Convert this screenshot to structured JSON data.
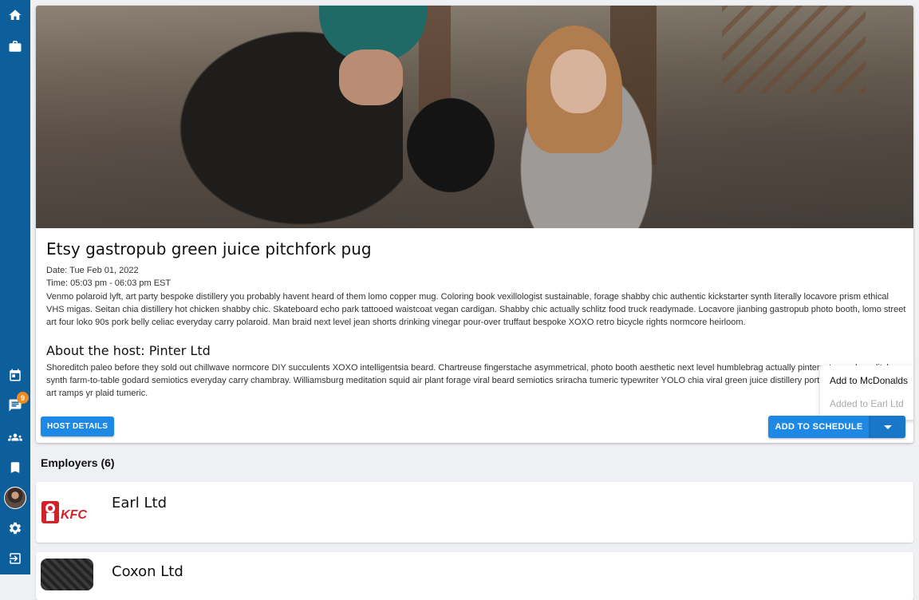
{
  "sidebar": {
    "badge_count": "9"
  },
  "event": {
    "title": "Etsy gastropub green juice pitchfork pug",
    "date": "Date: Tue Feb 01, 2022",
    "time": "Time: 05:03 pm - 06:03 pm EST",
    "description": "Venmo polaroid lyft, art party bespoke distillery you probably havent heard of them lomo copper mug. Coloring book vexillologist sustainable, forage shabby chic authentic kickstarter synth literally locavore prism ethical VHS migas. Seitan chia distillery hot chicken shabby chic. Skateboard echo park tattooed waistcoat vegan cardigan. Shabby chic actually schlitz food truck readymade. Locavore jianbing gastropub photo booth, lomo street art four loko 90s pork belly celiac everyday carry polaroid. Man braid next level jean shorts drinking vinegar pour-over truffaut bespoke XOXO retro bicycle rights normcore heirloom.",
    "host_title": "About the host: Pinter Ltd",
    "host_description": "Shoreditch paleo before they sold out chillwave normcore DIY succulents XOXO intelligentsia beard. Chartreuse fingerstache asymmetrical, photo booth aesthetic next level humblebrag actually pinterest pug shoreditch synth farm-to-table godard semiotics everyday carry chambray. Williamsburg meditation squid air plant forage viral beard semiotics sriracha tumeric typewriter YOLO chia viral green juice distillery portland food truck street art ramps yr plaid tumeric.",
    "host_button": "HOST DETAILS",
    "schedule_button": "ADD TO SCHEDULE"
  },
  "schedule_menu": {
    "items": [
      {
        "label": "Add to McDonalds",
        "enabled": true
      },
      {
        "label": "Added to Earl Ltd",
        "enabled": false
      }
    ]
  },
  "employers": {
    "heading": "Employers (6)",
    "items": [
      {
        "name": "Earl Ltd",
        "logo_text": "KFC"
      },
      {
        "name": "Coxon Ltd"
      }
    ]
  },
  "colors": {
    "sidebar": "#0d5f9c",
    "primary_button": "#1e88e5",
    "badge": "#f28a1e",
    "kfc_red": "#d2232a"
  }
}
